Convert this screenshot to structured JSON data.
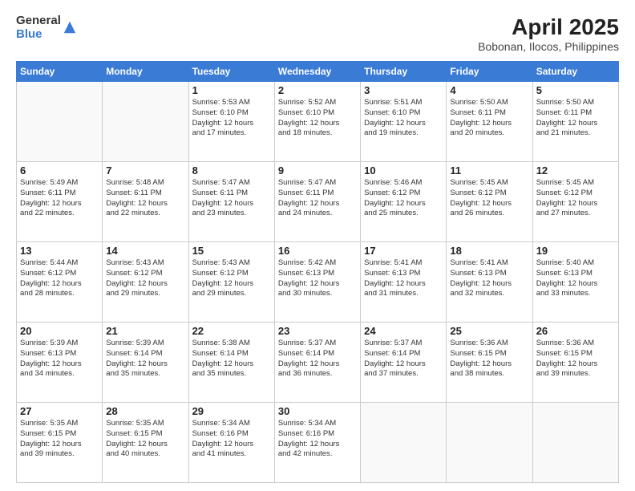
{
  "logo": {
    "line1": "General",
    "line2": "Blue"
  },
  "title": "April 2025",
  "subtitle": "Bobonan, Ilocos, Philippines",
  "weekdays": [
    "Sunday",
    "Monday",
    "Tuesday",
    "Wednesday",
    "Thursday",
    "Friday",
    "Saturday"
  ],
  "weeks": [
    [
      {
        "day": "",
        "info": ""
      },
      {
        "day": "",
        "info": ""
      },
      {
        "day": "1",
        "info": "Sunrise: 5:53 AM\nSunset: 6:10 PM\nDaylight: 12 hours\nand 17 minutes."
      },
      {
        "day": "2",
        "info": "Sunrise: 5:52 AM\nSunset: 6:10 PM\nDaylight: 12 hours\nand 18 minutes."
      },
      {
        "day": "3",
        "info": "Sunrise: 5:51 AM\nSunset: 6:10 PM\nDaylight: 12 hours\nand 19 minutes."
      },
      {
        "day": "4",
        "info": "Sunrise: 5:50 AM\nSunset: 6:11 PM\nDaylight: 12 hours\nand 20 minutes."
      },
      {
        "day": "5",
        "info": "Sunrise: 5:50 AM\nSunset: 6:11 PM\nDaylight: 12 hours\nand 21 minutes."
      }
    ],
    [
      {
        "day": "6",
        "info": "Sunrise: 5:49 AM\nSunset: 6:11 PM\nDaylight: 12 hours\nand 22 minutes."
      },
      {
        "day": "7",
        "info": "Sunrise: 5:48 AM\nSunset: 6:11 PM\nDaylight: 12 hours\nand 22 minutes."
      },
      {
        "day": "8",
        "info": "Sunrise: 5:47 AM\nSunset: 6:11 PM\nDaylight: 12 hours\nand 23 minutes."
      },
      {
        "day": "9",
        "info": "Sunrise: 5:47 AM\nSunset: 6:11 PM\nDaylight: 12 hours\nand 24 minutes."
      },
      {
        "day": "10",
        "info": "Sunrise: 5:46 AM\nSunset: 6:12 PM\nDaylight: 12 hours\nand 25 minutes."
      },
      {
        "day": "11",
        "info": "Sunrise: 5:45 AM\nSunset: 6:12 PM\nDaylight: 12 hours\nand 26 minutes."
      },
      {
        "day": "12",
        "info": "Sunrise: 5:45 AM\nSunset: 6:12 PM\nDaylight: 12 hours\nand 27 minutes."
      }
    ],
    [
      {
        "day": "13",
        "info": "Sunrise: 5:44 AM\nSunset: 6:12 PM\nDaylight: 12 hours\nand 28 minutes."
      },
      {
        "day": "14",
        "info": "Sunrise: 5:43 AM\nSunset: 6:12 PM\nDaylight: 12 hours\nand 29 minutes."
      },
      {
        "day": "15",
        "info": "Sunrise: 5:43 AM\nSunset: 6:12 PM\nDaylight: 12 hours\nand 29 minutes."
      },
      {
        "day": "16",
        "info": "Sunrise: 5:42 AM\nSunset: 6:13 PM\nDaylight: 12 hours\nand 30 minutes."
      },
      {
        "day": "17",
        "info": "Sunrise: 5:41 AM\nSunset: 6:13 PM\nDaylight: 12 hours\nand 31 minutes."
      },
      {
        "day": "18",
        "info": "Sunrise: 5:41 AM\nSunset: 6:13 PM\nDaylight: 12 hours\nand 32 minutes."
      },
      {
        "day": "19",
        "info": "Sunrise: 5:40 AM\nSunset: 6:13 PM\nDaylight: 12 hours\nand 33 minutes."
      }
    ],
    [
      {
        "day": "20",
        "info": "Sunrise: 5:39 AM\nSunset: 6:13 PM\nDaylight: 12 hours\nand 34 minutes."
      },
      {
        "day": "21",
        "info": "Sunrise: 5:39 AM\nSunset: 6:14 PM\nDaylight: 12 hours\nand 35 minutes."
      },
      {
        "day": "22",
        "info": "Sunrise: 5:38 AM\nSunset: 6:14 PM\nDaylight: 12 hours\nand 35 minutes."
      },
      {
        "day": "23",
        "info": "Sunrise: 5:37 AM\nSunset: 6:14 PM\nDaylight: 12 hours\nand 36 minutes."
      },
      {
        "day": "24",
        "info": "Sunrise: 5:37 AM\nSunset: 6:14 PM\nDaylight: 12 hours\nand 37 minutes."
      },
      {
        "day": "25",
        "info": "Sunrise: 5:36 AM\nSunset: 6:15 PM\nDaylight: 12 hours\nand 38 minutes."
      },
      {
        "day": "26",
        "info": "Sunrise: 5:36 AM\nSunset: 6:15 PM\nDaylight: 12 hours\nand 39 minutes."
      }
    ],
    [
      {
        "day": "27",
        "info": "Sunrise: 5:35 AM\nSunset: 6:15 PM\nDaylight: 12 hours\nand 39 minutes."
      },
      {
        "day": "28",
        "info": "Sunrise: 5:35 AM\nSunset: 6:15 PM\nDaylight: 12 hours\nand 40 minutes."
      },
      {
        "day": "29",
        "info": "Sunrise: 5:34 AM\nSunset: 6:16 PM\nDaylight: 12 hours\nand 41 minutes."
      },
      {
        "day": "30",
        "info": "Sunrise: 5:34 AM\nSunset: 6:16 PM\nDaylight: 12 hours\nand 42 minutes."
      },
      {
        "day": "",
        "info": ""
      },
      {
        "day": "",
        "info": ""
      },
      {
        "day": "",
        "info": ""
      }
    ]
  ]
}
